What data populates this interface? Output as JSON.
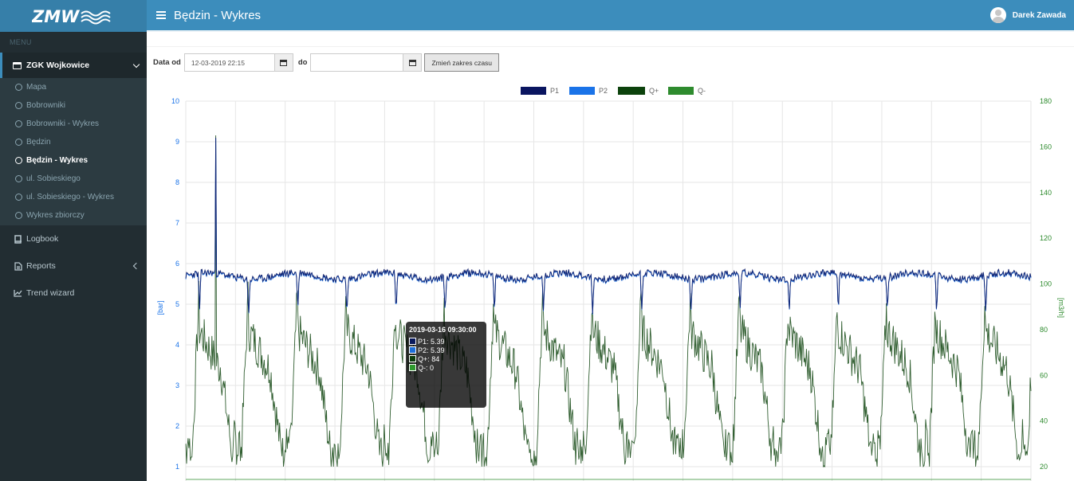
{
  "app": {
    "logo_text": "ZMW"
  },
  "header": {
    "title": "Będzin - Wykres",
    "user_name": "Darek Zawada"
  },
  "sidebar": {
    "menu_header": "MENU",
    "group": {
      "label": "ZGK Wojkowice",
      "items": [
        {
          "label": "Mapa",
          "active": false
        },
        {
          "label": "Bobrowniki",
          "active": false
        },
        {
          "label": "Bobrowniki - Wykres",
          "active": false
        },
        {
          "label": "Będzin",
          "active": false
        },
        {
          "label": "Będzin - Wykres",
          "active": true
        },
        {
          "label": "ul. Sobieskiego",
          "active": false
        },
        {
          "label": "ul. Sobieskiego - Wykres",
          "active": false
        },
        {
          "label": "Wykres zbiorczy",
          "active": false
        }
      ]
    },
    "items": [
      {
        "label": "Logbook",
        "icon": "book-icon"
      },
      {
        "label": "Reports",
        "icon": "file-icon"
      },
      {
        "label": "Trend wizard",
        "icon": "line-chart-icon"
      }
    ]
  },
  "filter": {
    "from_label": "Data od",
    "from_value": "12-03-2019 22:15",
    "to_label": "do",
    "to_value": "",
    "button_label": "Zmień zakres czasu"
  },
  "tooltip": {
    "title": "2019-03-16 09:30:00",
    "rows": [
      {
        "label": "P1: 5.39",
        "color": "#0a1a5c"
      },
      {
        "label": "P2: 5.39",
        "color": "#1e6fd9"
      },
      {
        "label": "Q+: 84",
        "color": "#0d3d0d"
      },
      {
        "label": "Q-: 0",
        "color": "#2e9a2e"
      }
    ]
  },
  "chart_data": {
    "type": "line",
    "legend": [
      {
        "name": "P1",
        "color": "#0a1560"
      },
      {
        "name": "P2",
        "color": "#1a73e8"
      },
      {
        "name": "Q+",
        "color": "#0c420c"
      },
      {
        "name": "Q-",
        "color": "#2e8b2e"
      }
    ],
    "legend_position": "top",
    "left_axis": {
      "label": "[bar]",
      "ylim": [
        1,
        10
      ],
      "ticks": [
        "10",
        "9",
        "8",
        "7",
        "6",
        "5",
        "4",
        "3",
        "2",
        "1"
      ],
      "color": "#1a73e8"
    },
    "right_axis": {
      "label": "[m3/h]",
      "ylim": [
        20,
        180
      ],
      "ticks": [
        "180",
        "160",
        "140",
        "120",
        "100",
        "80",
        "60",
        "40",
        "20"
      ],
      "color": "#2e8b2e"
    },
    "grid": true,
    "series": [
      {
        "name": "P1",
        "axis": "left",
        "baseline": 5.7,
        "dip_min": 4.6,
        "spike_max": 9.1
      },
      {
        "name": "P2",
        "axis": "left",
        "baseline": 5.7,
        "dip_min": 4.6
      },
      {
        "name": "Q+",
        "axis": "right",
        "daily_min": 25,
        "daily_max": 95,
        "spike_max": 165
      },
      {
        "name": "Q-",
        "axis": "right",
        "value": 0
      }
    ]
  }
}
